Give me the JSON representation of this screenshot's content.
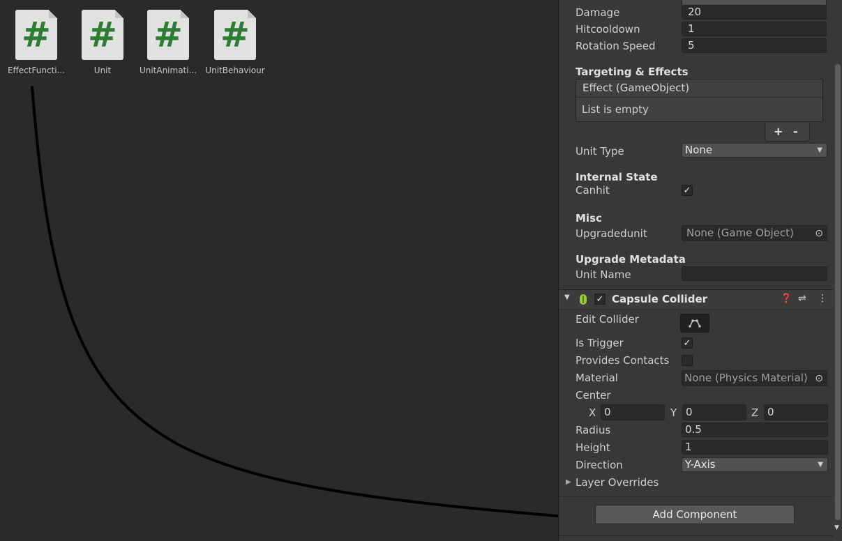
{
  "project": {
    "assets": [
      {
        "label": "EffectFuncti...",
        "glyph": "#"
      },
      {
        "label": "Unit",
        "glyph": "#"
      },
      {
        "label": "UnitAnimati...",
        "glyph": "#"
      },
      {
        "label": "UnitBehaviour",
        "glyph": "#"
      }
    ]
  },
  "inspector": {
    "top_fields": [
      {
        "label": "Damage",
        "value": "20"
      },
      {
        "label": "Hitcooldown",
        "value": "1"
      },
      {
        "label": "Rotation Speed",
        "value": "5"
      }
    ],
    "targeting": {
      "header": "Targeting & Effects",
      "list_title": "Effect (GameObject)",
      "list_empty": "List is empty",
      "add": "+",
      "remove": "-"
    },
    "unit_type": {
      "label": "Unit Type",
      "value": "None"
    },
    "internal_state": {
      "header": "Internal State",
      "label": "Canhit",
      "checked": true,
      "check_glyph": "✓"
    },
    "misc": {
      "header": "Misc",
      "label": "Upgradedunit",
      "value": "None (Game Object)"
    },
    "upgrade_metadata": {
      "header": "Upgrade Metadata",
      "label": "Unit Name",
      "value": ""
    },
    "capsule_collider": {
      "title": "Capsule Collider",
      "enabled_glyph": "✓",
      "edit_collider": "Edit Collider",
      "is_trigger": {
        "label": "Is Trigger",
        "checked": true,
        "glyph": "✓"
      },
      "provides_contacts": {
        "label": "Provides Contacts",
        "checked": false
      },
      "material": {
        "label": "Material",
        "value": "None (Physics Material)"
      },
      "center": {
        "label": "Center",
        "x_label": "X",
        "x": "0",
        "y_label": "Y",
        "y": "0",
        "z_label": "Z",
        "z": "0"
      },
      "radius": {
        "label": "Radius",
        "value": "0.5"
      },
      "height": {
        "label": "Height",
        "value": "1"
      },
      "direction": {
        "label": "Direction",
        "value": "Y-Axis"
      },
      "layer_overrides": "Layer Overrides"
    },
    "add_component": "Add Component"
  },
  "colors": {
    "script_icon_hash": "#2e7d32",
    "inspector_bg": "#383838",
    "project_bg": "#2a2a2a",
    "collider_icon": "#9ccc3a"
  }
}
